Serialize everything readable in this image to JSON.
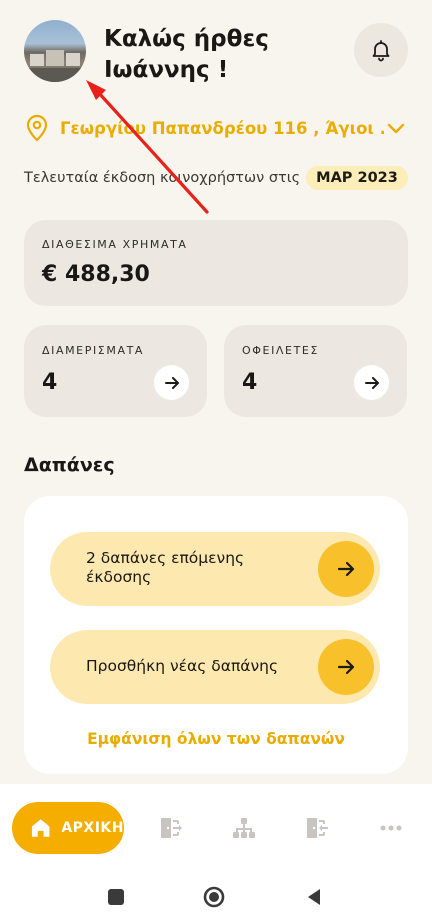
{
  "header": {
    "greeting_line1": "Καλώς ήρθες",
    "greeting_line2": "Ιωάννης !"
  },
  "address": {
    "text": "Γεωργίου Παπανδρέου 116 , Άγιοι ..."
  },
  "last_issue": {
    "label": "Τελευταία έκδοση κοινοχρήστων στις",
    "badge": "ΜΑΡ 2023"
  },
  "available_money": {
    "caption": "ΔΙΑΘΕΣΙΜΑ ΧΡΗΜΑΤΑ",
    "value": "€ 488,30"
  },
  "apartments": {
    "caption": "ΔΙΑΜΕΡΙΣΜΑΤΑ",
    "value": "4"
  },
  "debtors": {
    "caption": "ΟΦΕΙΛΕΤΕΣ",
    "value": "4"
  },
  "expenses": {
    "title": "Δαπάνες",
    "next_issue_line1": "2 δαπάνες επόμενης",
    "next_issue_line2": "έκδοσης",
    "add_new": "Προσθήκη νέας δαπάνης",
    "show_all": "Εμφάνιση όλων των δαπανών"
  },
  "nav": {
    "home_label": "ΑΡΧΙΚΗ",
    "icons": [
      "home-icon",
      "door-in-icon",
      "hierarchy-icon",
      "door-out-icon",
      "more-icon"
    ]
  },
  "colors": {
    "accent": "#f5ad00",
    "accent_text": "#e8ad00",
    "pill_bg": "#fde9b0",
    "card_bg": "#ece8e1",
    "page_bg": "#f8f4ee"
  }
}
